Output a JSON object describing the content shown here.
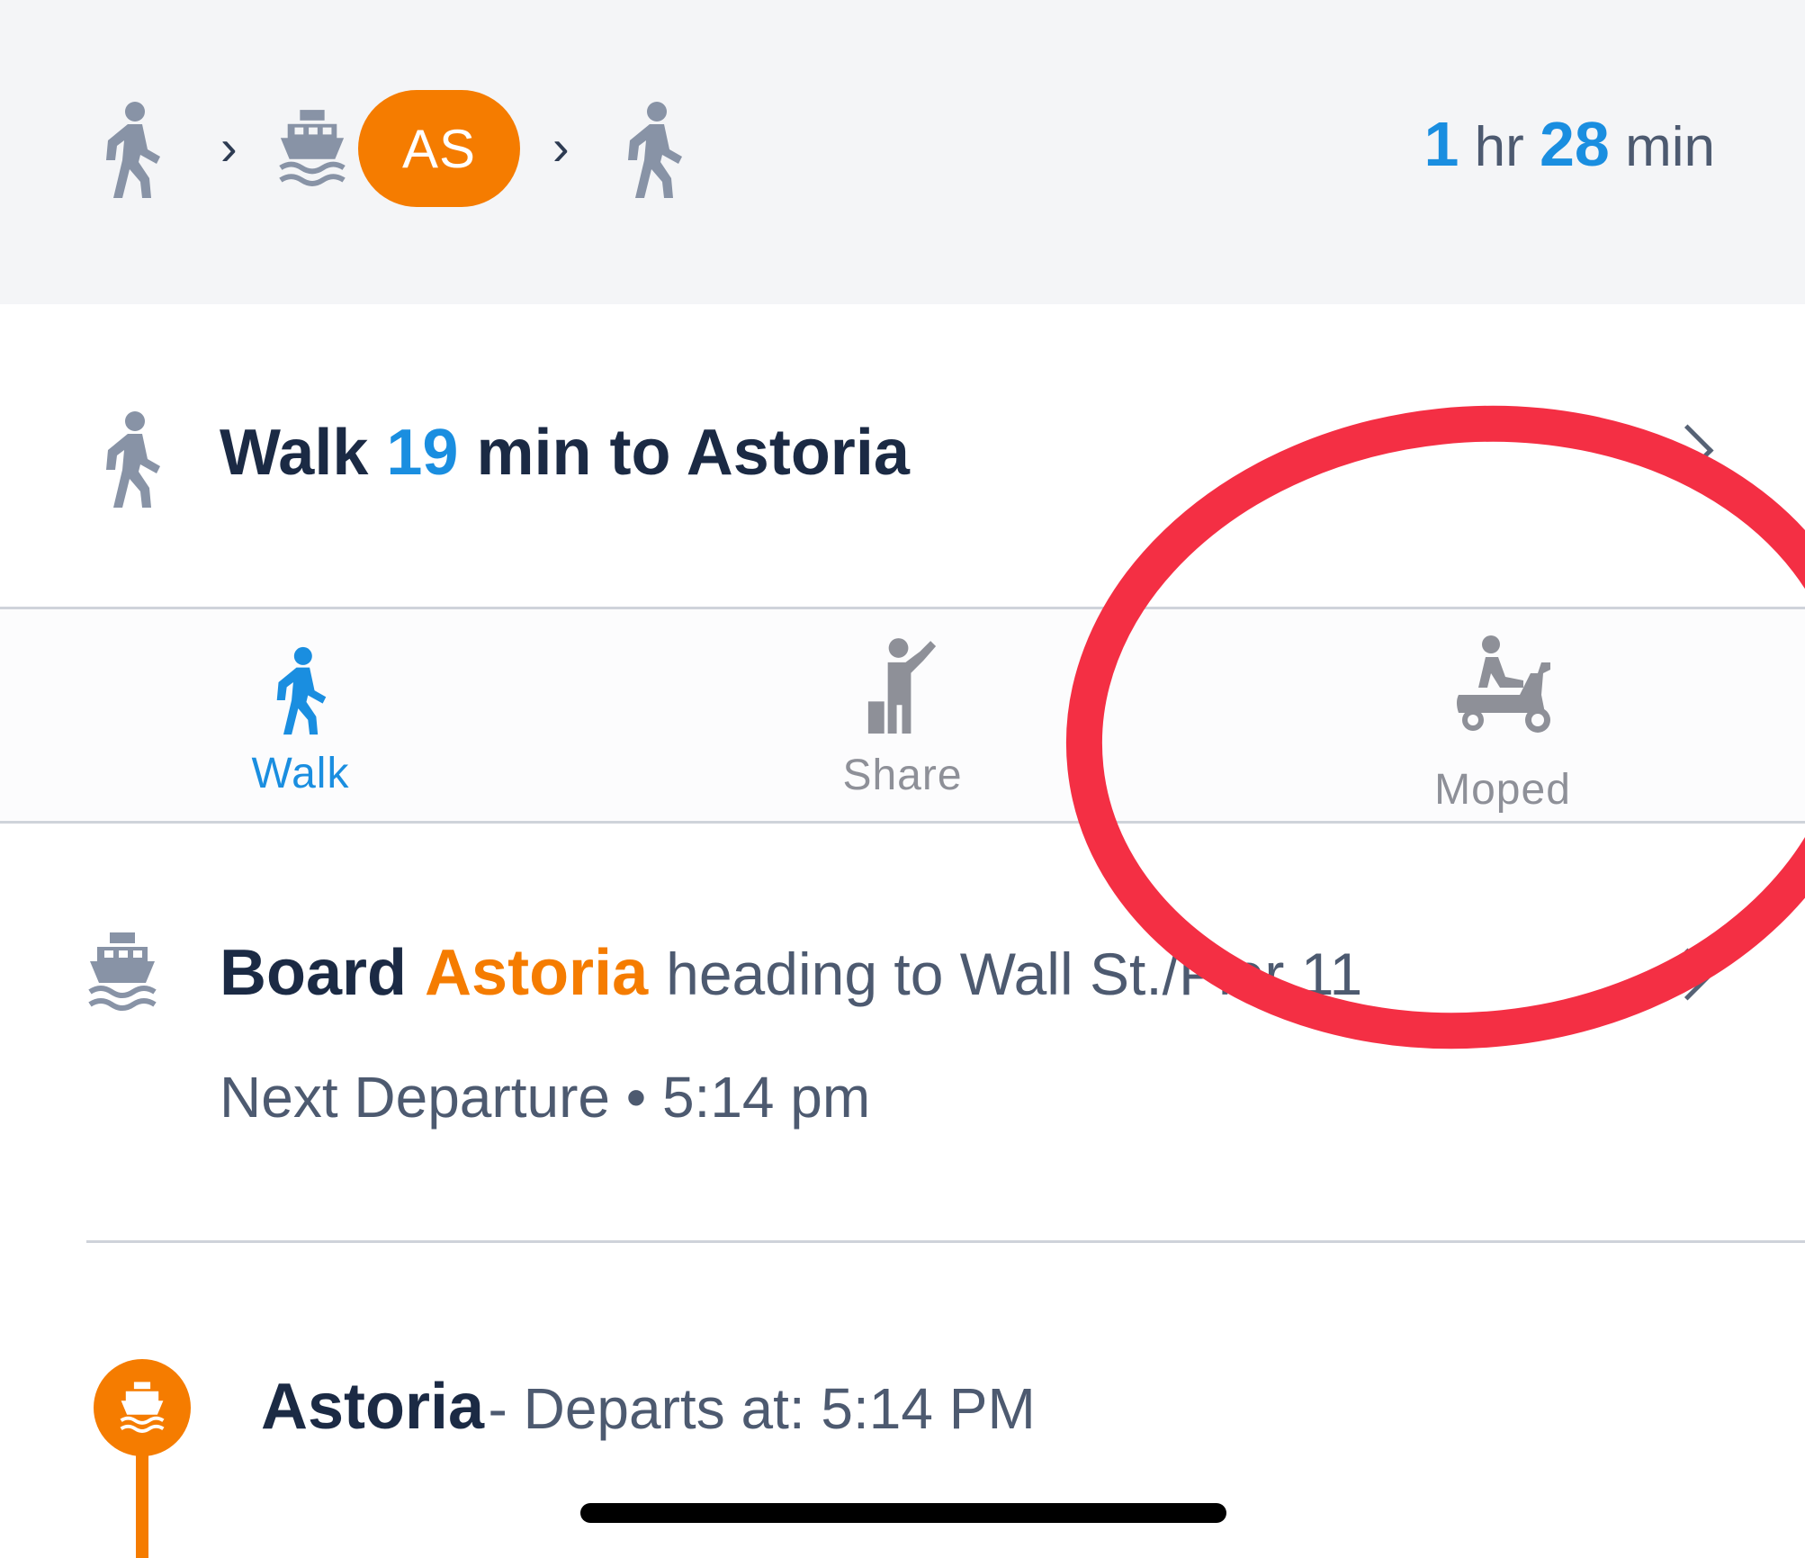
{
  "summary": {
    "badge_text": "AS",
    "duration": {
      "hours": "1",
      "hours_unit": "hr",
      "minutes": "28",
      "minutes_unit": "min"
    }
  },
  "walk_step": {
    "prefix": "Walk",
    "minutes": "19",
    "suffix": "min to Astoria"
  },
  "mode_tabs": [
    {
      "label": "Walk",
      "icon": "walk-icon",
      "selected": true
    },
    {
      "label": "Share",
      "icon": "hail-person-icon",
      "selected": false
    },
    {
      "label": "Moped",
      "icon": "moped-icon",
      "selected": false
    }
  ],
  "board_step": {
    "verb": "Board",
    "line": "Astoria",
    "heading": "heading to Wall St./Pier 11",
    "next_departure": "Next Departure • 5:14 pm"
  },
  "stop": {
    "name": "Astoria",
    "departs": "- Departs at: 5:14 PM"
  },
  "colors": {
    "accent_blue": "#1a8ee0",
    "ferry_orange": "#f57c00",
    "annotation_red": "#f42f44",
    "icon_gray": "#8893a6"
  }
}
